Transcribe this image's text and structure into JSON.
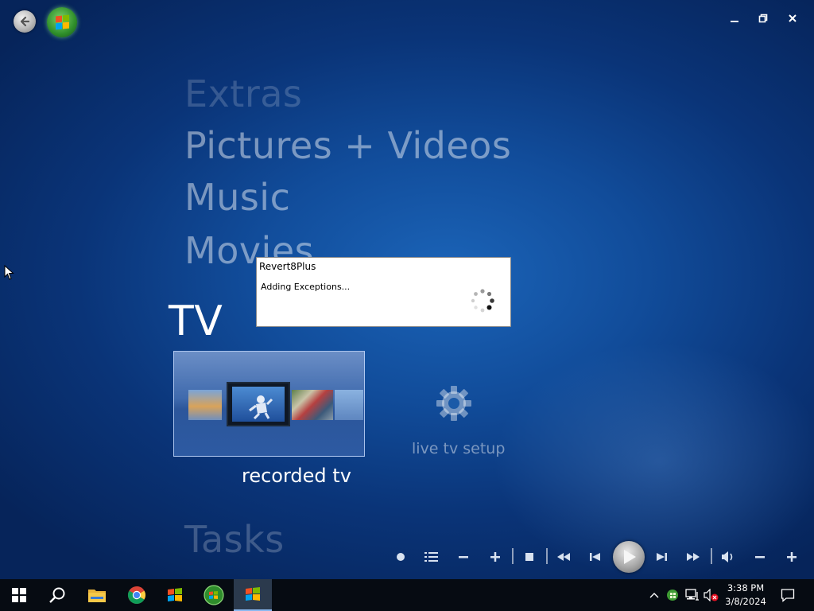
{
  "app": {
    "name": "Windows Media Center"
  },
  "menu": {
    "items": [
      {
        "label": "Extras"
      },
      {
        "label": "Pictures + Videos"
      },
      {
        "label": "Music"
      },
      {
        "label": "Movies"
      },
      {
        "label": "TV"
      },
      {
        "label": "Tasks"
      }
    ],
    "selected": "TV",
    "tv_tiles": [
      {
        "label": "recorded tv",
        "icon": "recorded-tv-thumbnail",
        "focused": true
      },
      {
        "label": "live tv setup",
        "icon": "gear-icon",
        "focused": false
      }
    ]
  },
  "dialog": {
    "title": "Revert8Plus",
    "message": "Adding Exceptions...",
    "icon": "loading-spinner"
  },
  "transport": {
    "buttons": [
      "record",
      "playlist",
      "minus",
      "plus",
      "stop",
      "rewind",
      "previous",
      "play",
      "next",
      "fast-forward",
      "volume",
      "volume-down",
      "volume-up"
    ]
  },
  "taskbar": {
    "apps": [
      "start",
      "search",
      "file-explorer",
      "chrome",
      "windows-media-player",
      "windows-media-center",
      "windows-media-center-active"
    ],
    "clock": {
      "time": "3:38 PM",
      "date": "3/8/2024"
    }
  },
  "colors": {
    "background": "#114c9a",
    "accent": "#8ab8f0",
    "menu_text": "#ffffff"
  }
}
